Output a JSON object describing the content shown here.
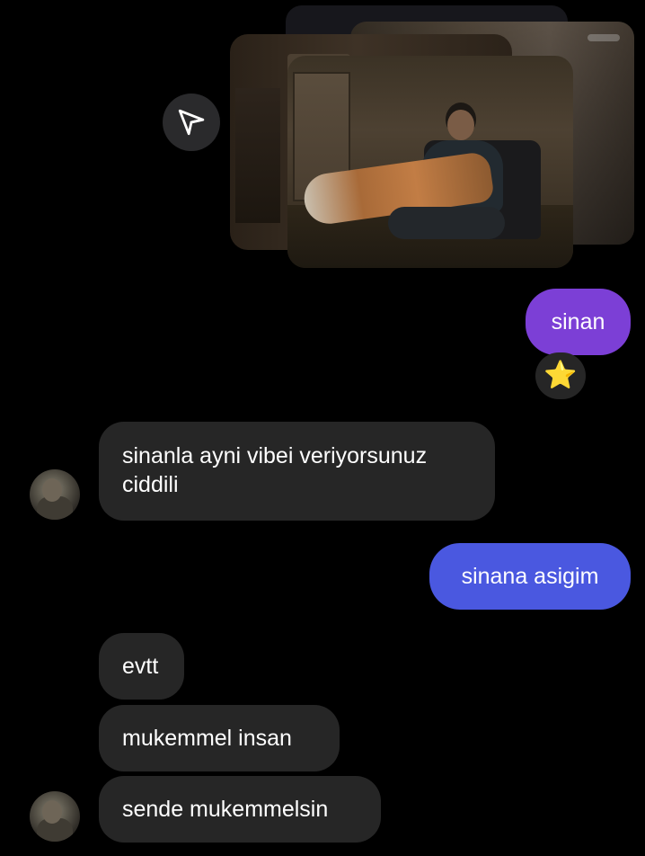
{
  "colors": {
    "background": "#000000",
    "incoming_bubble": "#262626",
    "outgoing_bubble_purple": "#7c3fd6",
    "outgoing_bubble_blue": "#4a58e0",
    "reaction_star": "#f5a623"
  },
  "shared_post": {
    "share_icon": "send-icon"
  },
  "messages": [
    {
      "id": "m1",
      "direction": "outgoing",
      "text": "sinan",
      "reaction": "⭐"
    },
    {
      "id": "m2",
      "direction": "incoming",
      "lines": [
        "sinanla ayni vibei veriyorsunuz",
        "ciddili"
      ]
    },
    {
      "id": "m3",
      "direction": "outgoing",
      "text": "sinana asigim"
    },
    {
      "id": "m4",
      "direction": "incoming",
      "text": "evtt"
    },
    {
      "id": "m5",
      "direction": "incoming",
      "text": "mukemmel insan"
    },
    {
      "id": "m6",
      "direction": "incoming",
      "text": "sende mukemmelsin"
    }
  ],
  "avatar_icon": "user-avatar"
}
